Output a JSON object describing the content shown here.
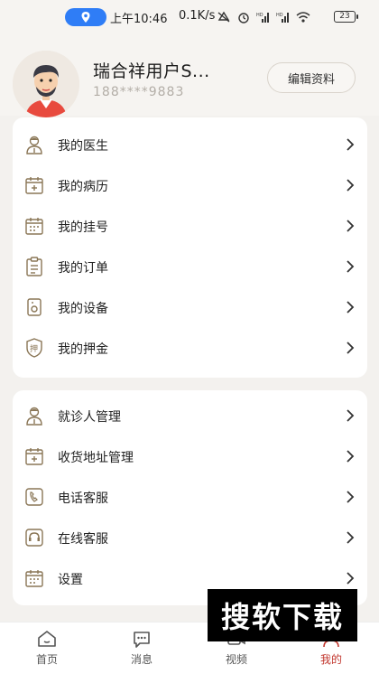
{
  "status_bar": {
    "time": "上午10:46",
    "speed": "0.1K/s",
    "battery": "23",
    "icons": [
      "location-icon",
      "mute-icon",
      "alarm-icon",
      "signal-hd-icon",
      "signal-hd-icon",
      "wifi-icon"
    ]
  },
  "profile": {
    "username": "瑞合祥用户S...",
    "phone": "188****9883",
    "edit_label": "编辑资料"
  },
  "menu_group_1": [
    {
      "label": "我的医生",
      "icon": "doctor-icon"
    },
    {
      "label": "我的病历",
      "icon": "medical-record-icon"
    },
    {
      "label": "我的挂号",
      "icon": "registration-calendar-icon"
    },
    {
      "label": "我的订单",
      "icon": "order-clipboard-icon"
    },
    {
      "label": "我的设备",
      "icon": "device-icon"
    },
    {
      "label": "我的押金",
      "icon": "deposit-shield-icon"
    }
  ],
  "menu_group_2": [
    {
      "label": "就诊人管理",
      "icon": "patient-icon"
    },
    {
      "label": "收货地址管理",
      "icon": "address-icon"
    },
    {
      "label": "电话客服",
      "icon": "phone-icon"
    },
    {
      "label": "在线客服",
      "icon": "headset-icon"
    },
    {
      "label": "设置",
      "icon": "settings-calendar-icon"
    }
  ],
  "tabs": [
    {
      "label": "首页",
      "icon": "home-icon"
    },
    {
      "label": "消息",
      "icon": "message-icon"
    },
    {
      "label": "视频",
      "icon": "video-icon"
    },
    {
      "label": "我的",
      "icon": "profile-icon",
      "active": true
    }
  ],
  "watermark": "搜软下载",
  "colors": {
    "accent": "#c2382f",
    "icon_brown": "#8a7656",
    "status_pill": "#2f7df6"
  }
}
